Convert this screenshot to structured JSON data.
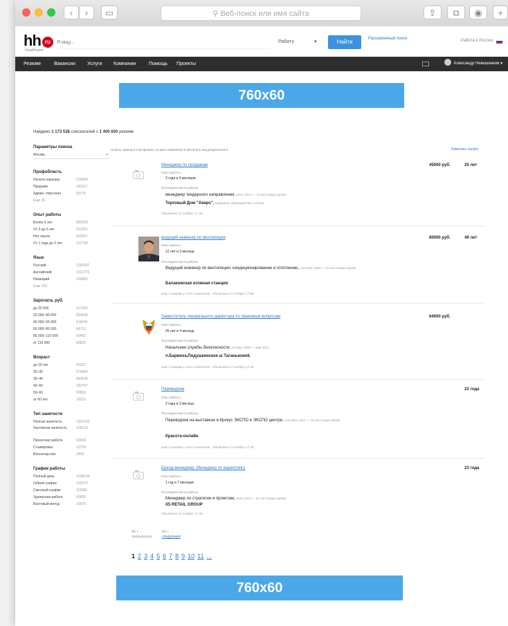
{
  "browser": {
    "address_placeholder": "Веб-поиск или имя сайта",
    "traffic_colors": [
      "#fc605c",
      "#fdbc40",
      "#34c84a"
    ]
  },
  "site": {
    "logo_text": "hh",
    "logo_badge": "ru",
    "logo_sub": "HeadHunter",
    "search_placeholder": "Я ищу...",
    "search_type": "Работу",
    "search_button": "Найти",
    "advanced_search": "Расширенный поиск",
    "region": "Работа в России",
    "accent": "#3c92e0"
  },
  "nav": {
    "items": [
      "Резюме",
      "Вакансии",
      "Услуги",
      "Компании",
      "Помощь",
      "Проекты"
    ],
    "user": "Александр Никишенков"
  },
  "banners": {
    "top": "760x60",
    "bottom": "760x60",
    "color": "#4aa8e8"
  },
  "summary": {
    "prefix": "Найдено ",
    "applicants": "1 173 538",
    "middle": " соискателей с ",
    "resumes": "1 400 650",
    "suffix": " резюме"
  },
  "sidebar": {
    "params_title": "Параметры поиска",
    "city": "Москва",
    "groups": [
      {
        "title": "Профобласть",
        "items": [
          [
            "Начало карьеры",
            "215896"
          ],
          [
            "Продажи",
            "181113"
          ],
          [
            "Админ. персонал",
            "99176"
          ]
        ],
        "more": "Еще 25"
      },
      {
        "title": "Опыт работы",
        "items": [
          [
            "Более 6 лет",
            "690530"
          ],
          [
            "От 3 до 6 лет",
            "261921"
          ],
          [
            "Нет опыта",
            "229357"
          ],
          [
            "От 1 года до 3 лет",
            "212799"
          ]
        ]
      },
      {
        "title": "Язык",
        "items": [
          [
            "Русский",
            "1282607"
          ],
          [
            "Английский",
            "1011776"
          ],
          [
            "Немецкий",
            "159805"
          ]
        ],
        "more": "Еще 103"
      },
      {
        "title": "Зарплата, руб.",
        "items": [
          [
            "до 20 000",
            "127414"
          ],
          [
            "20 000–40 000",
            "564566"
          ],
          [
            "40 000–65 000",
            "418046"
          ],
          [
            "65 000–85 000",
            "94712"
          ],
          [
            "85 000–110 000",
            "50462"
          ],
          [
            "от 110 000",
            "50835"
          ]
        ]
      },
      {
        "title": "Возраст",
        "items": [
          [
            "до 20 лет",
            "40252"
          ],
          [
            "20–30",
            "574693"
          ],
          [
            "30–40",
            "443508"
          ],
          [
            "40–50",
            "182707"
          ],
          [
            "50–60",
            "92899"
          ],
          [
            "от 60 лет",
            "15015"
          ]
        ]
      },
      {
        "title": "Тип занятости",
        "items": [
          [
            "Полная занятость",
            "1301392"
          ],
          [
            "Частичная занятость",
            "128129"
          ],
          [
            "Проектная работа",
            "33834"
          ],
          [
            "Стажировка",
            "15705"
          ],
          [
            "Волонтерство",
            "2458"
          ]
        ]
      },
      {
        "title": "График работы",
        "items": [
          [
            "Полный день",
            "1238139"
          ],
          [
            "Гибкий график",
            "139370"
          ],
          [
            "Сменный график",
            "119981"
          ],
          [
            "Удаленная работа",
            "43856"
          ],
          [
            "Вахтовый метод",
            "10070"
          ]
        ]
      }
    ]
  },
  "results": {
    "sortbar": "за весь период ▾  Сортировать по дате изменения ▾  Настроить вид результатов ▾",
    "edit": "Изменить запрос",
    "exp_label": "Опыт работы",
    "last_label": "Последнее место работы",
    "items": [
      {
        "title": "Менеджер по продажам",
        "salary": "45000 руб.",
        "age": "25 лет",
        "exp": "3 года и 9 месяцев",
        "job": "менеджер тендерного направления,",
        "job_meta": " июль 2013 — по настоящее время",
        "company": "Торговый Дом \"Аверс\",",
        "company_meta": " медицина, фармацевтика, аптеки",
        "more": "",
        "updated": "Обновлено 27 ноября, 17:39"
      },
      {
        "title": "ведущий инженер по вентиляции",
        "salary": "80000 руб.",
        "age": "49 лет",
        "exp": "12 лет и 3 месяца",
        "job": "Ведущий инженер по вентиляции, кондиционированию и отоплению,",
        "job_meta": " сентябрь 2002 — по настоящее время",
        "company": "Балаковская атомная станция",
        "company_meta": "",
        "more": "Еще 1 резюме у этого соискателя",
        "updated": "Обновлено 27 ноября, 17:39"
      },
      {
        "title": "Заместитель генерального директора по правовым вопросам",
        "salary": "64000 руб.",
        "age": "",
        "exp": "25 лет и 4 месяца",
        "job": "Начальник службы безопасности,",
        "job_meta": " октябрь 2009 — май 2013",
        "company": "п.Барвиха,Подушкинское ш Таганьково6.",
        "company_meta": "",
        "more": "Еще 1 резюме у этого соискателя",
        "updated": "Обновлено 27 ноября, 17:39"
      },
      {
        "title": "Переводчик",
        "salary": "",
        "age": "22 года",
        "exp": "2 года и 3 месяца",
        "job": "Переводчик на выставках в Крокус ЭКСПО и ЭКСПО центре,",
        "job_meta": " сентябрь 2012 — по настоящее время",
        "company": "Красота-онлайн",
        "company_meta": "",
        "more": "Еще 2 резюме у этого соискателя",
        "updated": "Обновлено 27 ноября, 17:39"
      },
      {
        "title": "Бренд-менеджер, Менеджер по маркетингу",
        "salary": "",
        "age": "23 года",
        "exp": "1 год и 7 месяцев",
        "job": "Менеджер по стратегии и проектам,",
        "job_meta": " июль 2013 — по настоящее время",
        "company": "X5 RETAIL GROUP",
        "company_meta": "",
        "more": "",
        "updated": "Обновлено 27 ноября, 17:39"
      }
    ]
  },
  "pager": {
    "prev_key": "Alt + ←",
    "prev": "предыдущая",
    "next_key": "Alt + →",
    "next": "следующая",
    "pages": [
      "1",
      "2",
      "3",
      "4",
      "5",
      "6",
      "7",
      "8",
      "9",
      "10",
      "11",
      "..."
    ]
  }
}
